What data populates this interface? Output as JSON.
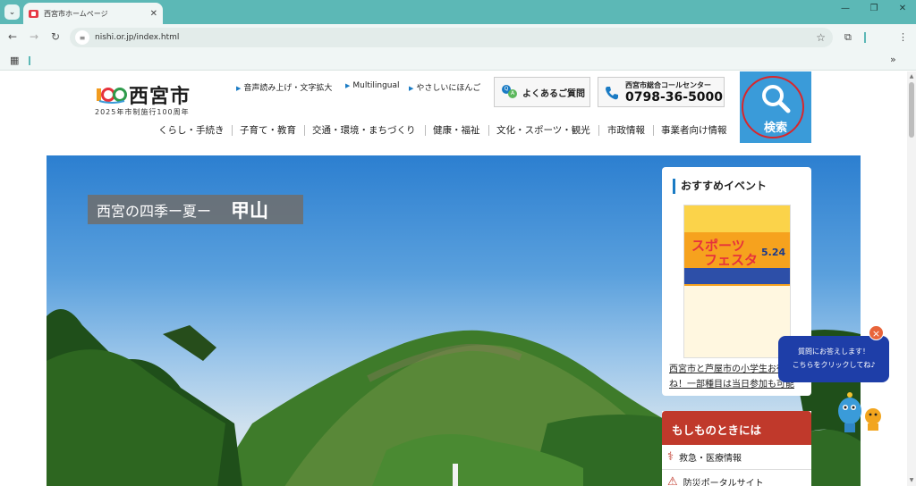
{
  "browser": {
    "tab_title": "西宮市ホームページ",
    "url": "nishi.or.jp/index.html"
  },
  "site": {
    "logo_name": "西宮市",
    "logo_sub": "2025年市制施行100周年",
    "util_links": [
      "音声読み上げ・文字拡大",
      "Multilingual",
      "やさしいにほんご"
    ],
    "faq_label": "よくあるご質問",
    "call_title": "西宮市総合コールセンター",
    "call_number": "0798-36-5000",
    "search_label": "検索",
    "gnav": [
      "くらし・手続き",
      "子育て・教育",
      "交通・環境・まちづくり",
      "健康・福祉",
      "文化・スポーツ・観光",
      "市政情報",
      "事業者向け情報"
    ]
  },
  "hero": {
    "caption": "西宮の四季ー夏ー",
    "caption_place": "甲山"
  },
  "events": {
    "title": "おすすめイベント",
    "poster_line1": "スポーツ",
    "poster_line2": "フェスタ",
    "poster_date": "5.24",
    "text": "西宮市と芦屋市の小学生お待ちかね！一部種目は当日参加も可能"
  },
  "emergency": {
    "title": "もしものときには",
    "items": [
      "救急・医療情報",
      "防災ポータルサイト"
    ]
  },
  "chat": {
    "line1": "質問にお答えします！",
    "line2": "こちらをクリックしてね♪",
    "close": "×"
  }
}
